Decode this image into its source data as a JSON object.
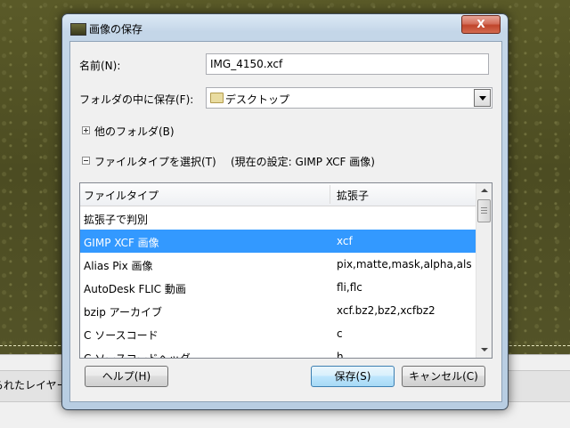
{
  "background": {
    "status_text": "られたレイヤー"
  },
  "dialog": {
    "title": "画像の保存",
    "close_label": "X"
  },
  "form": {
    "name_label": "名前(N):",
    "name_value": "IMG_4150.xcf",
    "folder_label": "フォルダの中に保存(F):",
    "folder_value": "デスクトップ",
    "other_folders_label": "他のフォルダ(B)",
    "file_type_label": "ファイルタイプを選択(T)",
    "current_setting": "(現在の設定: GIMP XCF 画像)"
  },
  "file_types": {
    "header_type": "ファイルタイプ",
    "header_ext": "拡張子",
    "rows": [
      {
        "type": "拡張子で判別",
        "ext": ""
      },
      {
        "type": "GIMP XCF 画像",
        "ext": "xcf"
      },
      {
        "type": "Alias Pix 画像",
        "ext": "pix,matte,mask,alpha,als"
      },
      {
        "type": "AutoDesk FLIC 動画",
        "ext": "fli,flc"
      },
      {
        "type": "bzip アーカイブ",
        "ext": "xcf.bz2,bz2,xcfbz2"
      },
      {
        "type": "C ソースコード",
        "ext": "c"
      },
      {
        "type": "C ソースコードヘッダ",
        "ext": "h"
      }
    ],
    "selected_index": 1
  },
  "buttons": {
    "help": "ヘルプ(H)",
    "save": "保存(S)",
    "cancel": "キャンセル(C)"
  },
  "colors": {
    "selection": "#3399ff"
  }
}
